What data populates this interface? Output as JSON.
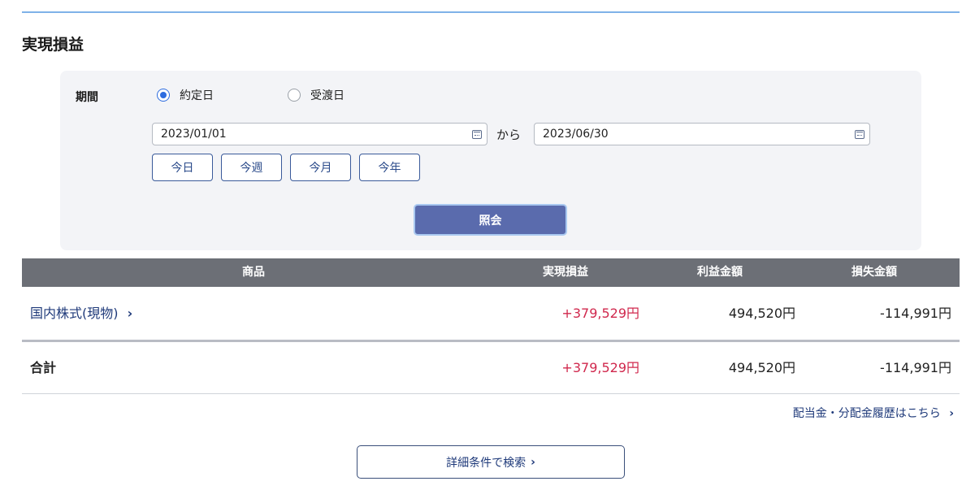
{
  "page": {
    "title": "実現損益"
  },
  "filter": {
    "period_label": "期間",
    "radio_options": [
      {
        "label": "約定日",
        "checked": true
      },
      {
        "label": "受渡日",
        "checked": false
      }
    ],
    "date_from": "2023/01/01",
    "separator": "から",
    "date_to": "2023/06/30",
    "quick_buttons": [
      "今日",
      "今週",
      "今月",
      "今年"
    ],
    "inquiry_label": "照会"
  },
  "table": {
    "headers": {
      "product": "商品",
      "realized": "実現損益",
      "profit": "利益金額",
      "loss": "損失金額"
    },
    "rows": [
      {
        "product": "国内株式(現物)",
        "chevron": "›",
        "realized": "+379,529円",
        "profit": "494,520円",
        "loss": "-114,991円"
      }
    ],
    "total": {
      "label": "合計",
      "realized": "+379,529円",
      "profit": "494,520円",
      "loss": "-114,991円"
    }
  },
  "links": {
    "dividend": "配当金・分配金履歴はこちら",
    "dividend_chevron": "›",
    "detail_search": "詳細条件で検索",
    "detail_chevron": "›"
  },
  "colors": {
    "gain": "#d0284d",
    "accent_blue": "#2d6cdf",
    "header_bg": "#6c6f76",
    "button_bg": "#5a6bad"
  },
  "icons": {
    "calendar": "calendar-icon",
    "chevron": "chevron-right-icon"
  }
}
